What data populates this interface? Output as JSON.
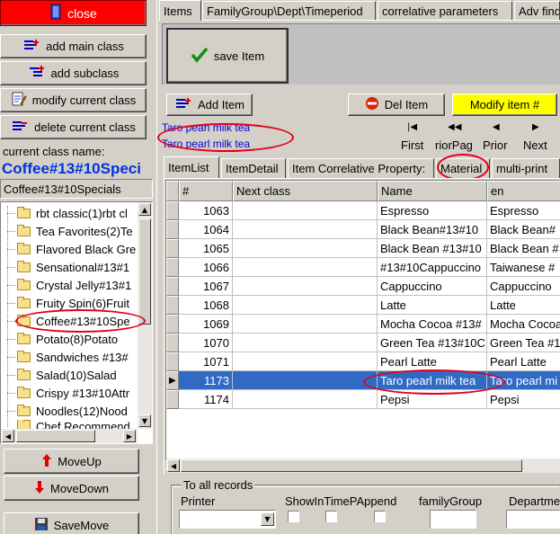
{
  "left": {
    "close_label": "close",
    "add_main_label": "add main class",
    "add_sub_label": "add subclass",
    "modify_label": "modify current class",
    "delete_label": "delete current class",
    "current_class_caption": "current class name:",
    "current_class_name": "Coffee#13#10Speci",
    "current_class_full": "Coffee#13#10Specials",
    "tree_items": [
      "rbt classic(1)rbt cl",
      "Tea Favorites(2)Te",
      "Flavored Black Gre",
      "Sensational#13#1",
      "Crystal Jelly#13#1",
      "Fruity Spin(6)Fruit",
      "Coffee#13#10Spe",
      "Potato(8)Potato",
      "Sandwiches #13#",
      "Salad(10)Salad",
      "Crispy #13#10Attr",
      "Noodles(12)Nood",
      "Chef Recommend"
    ],
    "moveup_label": "MoveUp",
    "movedown_label": "MoveDown",
    "savemove_label": "SaveMove"
  },
  "tabs": [
    "Items",
    "FamilyGroup\\Dept\\Timeperiod",
    "correlative parameters",
    "Adv find"
  ],
  "toolbar": {
    "save_label": "save Item",
    "add_label": "Add Item",
    "del_label": "Del Item",
    "modify_label": "Modify item #"
  },
  "item_names": [
    "Taro pearl milk tea",
    "Taro pearl milk tea"
  ],
  "nav": {
    "first": "First",
    "prior_page": "riorPag",
    "prior": "Prior",
    "next": "Next"
  },
  "subtabs": [
    "ItemList",
    "ItemDetail",
    "Item Correlative Property:",
    "Material",
    "multi-print"
  ],
  "grid": {
    "columns": [
      "#",
      "Next class",
      "Name",
      "en"
    ],
    "rows": [
      {
        "id": "1063",
        "next": "",
        "name": "Espresso",
        "en": "Espresso"
      },
      {
        "id": "1064",
        "next": "",
        "name": "Black Bean#13#10",
        "en": "Black Bean#"
      },
      {
        "id": "1065",
        "next": "",
        "name": "Black Bean #13#10",
        "en": "Black Bean #"
      },
      {
        "id": "1066",
        "next": "",
        "name": "#13#10Cappuccino",
        "en": "Taiwanese #"
      },
      {
        "id": "1067",
        "next": "",
        "name": "Cappuccino",
        "en": "Cappuccino"
      },
      {
        "id": "1068",
        "next": "",
        "name": "Latte",
        "en": "Latte"
      },
      {
        "id": "1069",
        "next": "",
        "name": "Mocha Cocoa #13#",
        "en": "Mocha Cocoa"
      },
      {
        "id": "1070",
        "next": "",
        "name": "Green Tea #13#10C",
        "en": "Green Tea #1"
      },
      {
        "id": "1071",
        "next": "",
        "name": "Pearl Latte",
        "en": "Pearl Latte"
      },
      {
        "id": "1173",
        "next": "",
        "name": "Taro pearl milk tea",
        "en": "Taro pearl mi"
      },
      {
        "id": "1174",
        "next": "",
        "name": "Pepsi",
        "en": "Pepsi"
      }
    ],
    "selected_row_id": "1173"
  },
  "bottom": {
    "group_label": "To all records",
    "printer_label": "Printer",
    "show_label": "ShowInTimePAppend",
    "family_label": "familyGroup",
    "dept_label": "Departme"
  },
  "colors": {
    "close_bg": "#ff0000",
    "accent_blue": "#0000cc",
    "modify_bg": "#ffff00",
    "selection": "#316ac5",
    "annotation_red": "#e0001b"
  }
}
